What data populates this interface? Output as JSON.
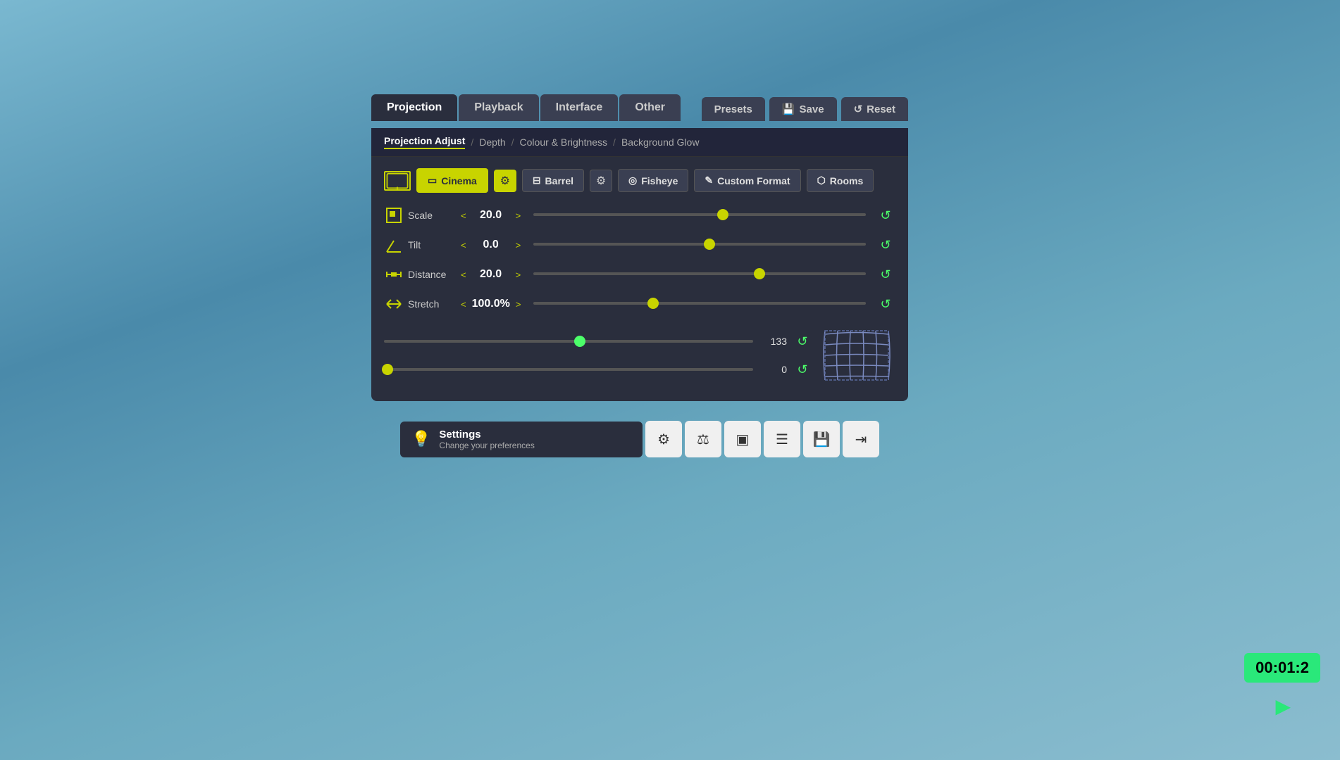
{
  "tabs": [
    {
      "id": "projection",
      "label": "Projection",
      "active": true
    },
    {
      "id": "playback",
      "label": "Playback",
      "active": false
    },
    {
      "id": "interface",
      "label": "Interface",
      "active": false
    },
    {
      "id": "other",
      "label": "Other",
      "active": false
    }
  ],
  "tab_actions": [
    {
      "id": "presets",
      "label": "Presets"
    },
    {
      "id": "save",
      "label": "Save",
      "icon": "💾"
    },
    {
      "id": "reset",
      "label": "Reset",
      "icon": "↺"
    }
  ],
  "breadcrumb": {
    "active": "Projection Adjust",
    "items": [
      {
        "label": "Depth"
      },
      {
        "label": "Colour & Brightness"
      },
      {
        "label": "Background Glow"
      }
    ]
  },
  "format_buttons": [
    {
      "id": "cinema",
      "label": "Cinema",
      "active": true
    },
    {
      "id": "barrel",
      "label": "Barrel",
      "active": false
    },
    {
      "id": "fisheye",
      "label": "Fisheye",
      "active": false
    },
    {
      "id": "custom_format",
      "label": "Custom Format",
      "active": false
    },
    {
      "id": "rooms",
      "label": "Rooms",
      "active": false
    }
  ],
  "sliders": [
    {
      "id": "scale",
      "label": "Scale",
      "value": "20.0",
      "thumb_pct": 57,
      "icon": "scale"
    },
    {
      "id": "tilt",
      "label": "Tilt",
      "value": "0.0",
      "thumb_pct": 53,
      "icon": "tilt"
    },
    {
      "id": "distance",
      "label": "Distance",
      "value": "20.0",
      "thumb_pct": 68,
      "icon": "distance"
    },
    {
      "id": "stretch",
      "label": "Stretch",
      "value": "100.0%",
      "thumb_pct": 36,
      "icon": "stretch"
    }
  ],
  "barrel_sliders": [
    {
      "id": "barrel_top",
      "value": "133",
      "thumb_pct": 53,
      "green": true
    },
    {
      "id": "barrel_bottom",
      "value": "0",
      "thumb_pct": 1,
      "green": false
    }
  ],
  "bottom_toolbar": {
    "settings_title": "Settings",
    "settings_subtitle": "Change your preferences",
    "buttons": [
      {
        "id": "gear",
        "icon": "⚙"
      },
      {
        "id": "person",
        "icon": "⚖"
      },
      {
        "id": "screen",
        "icon": "▣"
      },
      {
        "id": "menu",
        "icon": "☰"
      },
      {
        "id": "save_file",
        "icon": "💾"
      },
      {
        "id": "export",
        "icon": "⇥"
      }
    ]
  },
  "timer": {
    "value": "00:01:2"
  }
}
